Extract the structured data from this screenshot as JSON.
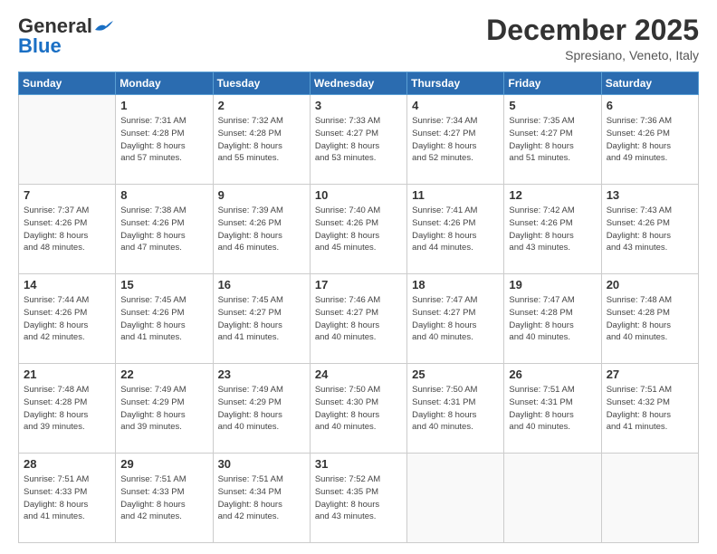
{
  "header": {
    "logo_general": "General",
    "logo_blue": "Blue",
    "month": "December 2025",
    "location": "Spresiano, Veneto, Italy"
  },
  "weekdays": [
    "Sunday",
    "Monday",
    "Tuesday",
    "Wednesday",
    "Thursday",
    "Friday",
    "Saturday"
  ],
  "weeks": [
    [
      {
        "day": "",
        "info": ""
      },
      {
        "day": "1",
        "info": "Sunrise: 7:31 AM\nSunset: 4:28 PM\nDaylight: 8 hours\nand 57 minutes."
      },
      {
        "day": "2",
        "info": "Sunrise: 7:32 AM\nSunset: 4:28 PM\nDaylight: 8 hours\nand 55 minutes."
      },
      {
        "day": "3",
        "info": "Sunrise: 7:33 AM\nSunset: 4:27 PM\nDaylight: 8 hours\nand 53 minutes."
      },
      {
        "day": "4",
        "info": "Sunrise: 7:34 AM\nSunset: 4:27 PM\nDaylight: 8 hours\nand 52 minutes."
      },
      {
        "day": "5",
        "info": "Sunrise: 7:35 AM\nSunset: 4:27 PM\nDaylight: 8 hours\nand 51 minutes."
      },
      {
        "day": "6",
        "info": "Sunrise: 7:36 AM\nSunset: 4:26 PM\nDaylight: 8 hours\nand 49 minutes."
      }
    ],
    [
      {
        "day": "7",
        "info": "Sunrise: 7:37 AM\nSunset: 4:26 PM\nDaylight: 8 hours\nand 48 minutes."
      },
      {
        "day": "8",
        "info": "Sunrise: 7:38 AM\nSunset: 4:26 PM\nDaylight: 8 hours\nand 47 minutes."
      },
      {
        "day": "9",
        "info": "Sunrise: 7:39 AM\nSunset: 4:26 PM\nDaylight: 8 hours\nand 46 minutes."
      },
      {
        "day": "10",
        "info": "Sunrise: 7:40 AM\nSunset: 4:26 PM\nDaylight: 8 hours\nand 45 minutes."
      },
      {
        "day": "11",
        "info": "Sunrise: 7:41 AM\nSunset: 4:26 PM\nDaylight: 8 hours\nand 44 minutes."
      },
      {
        "day": "12",
        "info": "Sunrise: 7:42 AM\nSunset: 4:26 PM\nDaylight: 8 hours\nand 43 minutes."
      },
      {
        "day": "13",
        "info": "Sunrise: 7:43 AM\nSunset: 4:26 PM\nDaylight: 8 hours\nand 43 minutes."
      }
    ],
    [
      {
        "day": "14",
        "info": "Sunrise: 7:44 AM\nSunset: 4:26 PM\nDaylight: 8 hours\nand 42 minutes."
      },
      {
        "day": "15",
        "info": "Sunrise: 7:45 AM\nSunset: 4:26 PM\nDaylight: 8 hours\nand 41 minutes."
      },
      {
        "day": "16",
        "info": "Sunrise: 7:45 AM\nSunset: 4:27 PM\nDaylight: 8 hours\nand 41 minutes."
      },
      {
        "day": "17",
        "info": "Sunrise: 7:46 AM\nSunset: 4:27 PM\nDaylight: 8 hours\nand 40 minutes."
      },
      {
        "day": "18",
        "info": "Sunrise: 7:47 AM\nSunset: 4:27 PM\nDaylight: 8 hours\nand 40 minutes."
      },
      {
        "day": "19",
        "info": "Sunrise: 7:47 AM\nSunset: 4:28 PM\nDaylight: 8 hours\nand 40 minutes."
      },
      {
        "day": "20",
        "info": "Sunrise: 7:48 AM\nSunset: 4:28 PM\nDaylight: 8 hours\nand 40 minutes."
      }
    ],
    [
      {
        "day": "21",
        "info": "Sunrise: 7:48 AM\nSunset: 4:28 PM\nDaylight: 8 hours\nand 39 minutes."
      },
      {
        "day": "22",
        "info": "Sunrise: 7:49 AM\nSunset: 4:29 PM\nDaylight: 8 hours\nand 39 minutes."
      },
      {
        "day": "23",
        "info": "Sunrise: 7:49 AM\nSunset: 4:29 PM\nDaylight: 8 hours\nand 40 minutes."
      },
      {
        "day": "24",
        "info": "Sunrise: 7:50 AM\nSunset: 4:30 PM\nDaylight: 8 hours\nand 40 minutes."
      },
      {
        "day": "25",
        "info": "Sunrise: 7:50 AM\nSunset: 4:31 PM\nDaylight: 8 hours\nand 40 minutes."
      },
      {
        "day": "26",
        "info": "Sunrise: 7:51 AM\nSunset: 4:31 PM\nDaylight: 8 hours\nand 40 minutes."
      },
      {
        "day": "27",
        "info": "Sunrise: 7:51 AM\nSunset: 4:32 PM\nDaylight: 8 hours\nand 41 minutes."
      }
    ],
    [
      {
        "day": "28",
        "info": "Sunrise: 7:51 AM\nSunset: 4:33 PM\nDaylight: 8 hours\nand 41 minutes."
      },
      {
        "day": "29",
        "info": "Sunrise: 7:51 AM\nSunset: 4:33 PM\nDaylight: 8 hours\nand 42 minutes."
      },
      {
        "day": "30",
        "info": "Sunrise: 7:51 AM\nSunset: 4:34 PM\nDaylight: 8 hours\nand 42 minutes."
      },
      {
        "day": "31",
        "info": "Sunrise: 7:52 AM\nSunset: 4:35 PM\nDaylight: 8 hours\nand 43 minutes."
      },
      {
        "day": "",
        "info": ""
      },
      {
        "day": "",
        "info": ""
      },
      {
        "day": "",
        "info": ""
      }
    ]
  ]
}
